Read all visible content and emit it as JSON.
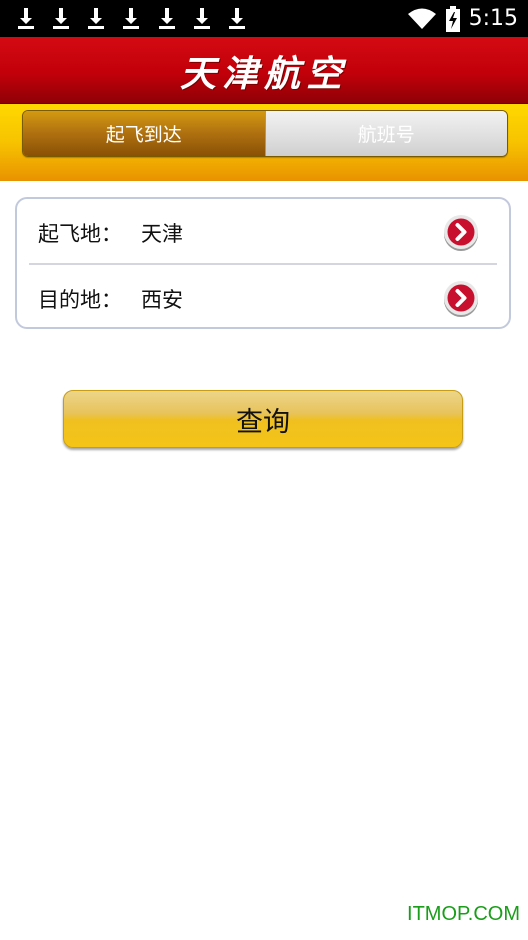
{
  "status_bar": {
    "time": "5:15",
    "icons": [
      "download-icon",
      "download-icon",
      "download-icon",
      "download-icon",
      "download-icon",
      "download-icon",
      "download-icon",
      "wifi-icon",
      "battery-charging-icon"
    ]
  },
  "header": {
    "logo_text": "天津航空"
  },
  "tabs": [
    {
      "label": "起飞到达",
      "active": true
    },
    {
      "label": "航班号",
      "active": false
    }
  ],
  "form": {
    "departure": {
      "label": "起飞地：",
      "value": "天津"
    },
    "destination": {
      "label": "目的地：",
      "value": "西安"
    }
  },
  "query_button": {
    "label": "查询"
  },
  "watermark": "ITMOP.COM",
  "colors": {
    "header_red": "#c2000a",
    "tab_band_yellow": "#f7c300",
    "button_gold": "#f4c418",
    "arrow_red": "#c8102e",
    "watermark_green": "#1a9e1a"
  }
}
